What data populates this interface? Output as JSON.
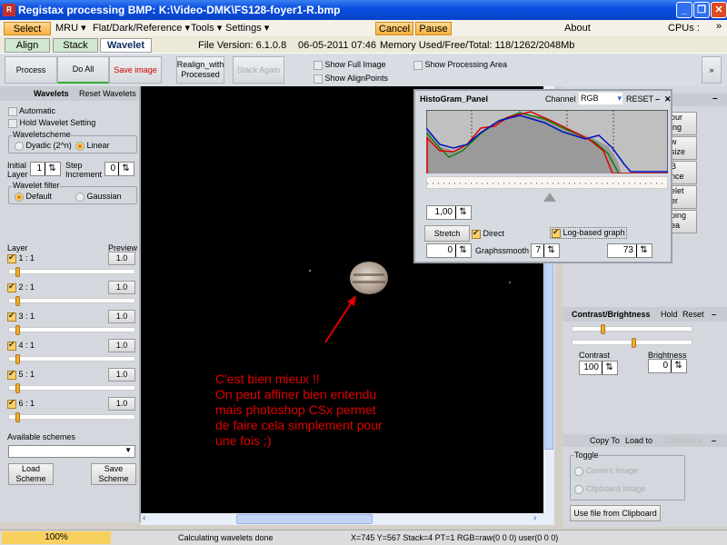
{
  "window": {
    "title": "Registax processing BMP: K:\\Video-DMK\\FS128-foyer1-R.bmp",
    "minimize": "_",
    "maximize": "❐",
    "close": "✕"
  },
  "menu": {
    "select": "Select",
    "mru": "MRU ▾",
    "flat": "Flat/Dark/Reference ▾",
    "tools": "Tools ▾",
    "settings": "Settings ▾",
    "cancel": "Cancel",
    "pause": "Pause",
    "about": "About",
    "cpus": "CPUs :",
    "more": "»"
  },
  "tabs": [
    {
      "label": "Align"
    },
    {
      "label": "Stack"
    },
    {
      "label": "Wavelet"
    }
  ],
  "info": {
    "version": "File Version: 6.1.0.8",
    "date": "06-05-2011 07:46",
    "memory": "Memory Used/Free/Total: 118/1262/2048Mb"
  },
  "toolbar": {
    "process": "Process",
    "do_all": "Do All",
    "save_image": "Save image",
    "realign1": "Realign_with",
    "realign2": "Processed",
    "stack_again": "Stack Again",
    "show_full": "Show Full Image",
    "show_align": "Show AlignPoints",
    "show_area": "Show Processing Area",
    "expand": "»"
  },
  "wavelets": {
    "title": "Wavelets",
    "reset": "Reset Wavelets",
    "automatic": "Automatic",
    "hold": "Hold Wavelet Setting",
    "scheme": "Waveletscheme",
    "dyadic": "Dyadic (2^n)",
    "linear": "Linear",
    "initial1": "Initial",
    "initial2": "Layer",
    "initial_val": "1",
    "step1": "Step",
    "step2": "Increment",
    "step_val": "0",
    "filter": "Wavelet filter",
    "default": "Default",
    "gaussian": "Gaussian",
    "layer": "Layer",
    "preview": "Preview",
    "layers": [
      {
        "label": "1 : 1",
        "value": "1.0",
        "checked": true
      },
      {
        "label": "2 : 1",
        "value": "1.0",
        "checked": true
      },
      {
        "label": "3 : 1",
        "value": "1.0",
        "checked": true
      },
      {
        "label": "4 : 1",
        "value": "1.0",
        "checked": true
      },
      {
        "label": "5 : 1",
        "value": "1.0",
        "checked": true
      },
      {
        "label": "6 : 1",
        "value": "1.0",
        "checked": true
      }
    ],
    "available": "Available schemes",
    "load": "Load Scheme",
    "save": "Save Scheme"
  },
  "histogram": {
    "title": "HistoGram_Panel",
    "channel": "Channel",
    "channel_value": "RGB",
    "reset": "RESET",
    "minimize": "–",
    "close": "✕",
    "gamma": "1,00",
    "stretch": "Stretch",
    "direct": "Direct",
    "log": "Log-based graph",
    "low": "0",
    "graphsmooth": "Graphssmooth",
    "smooth_val": "7",
    "high": "73",
    "colors": {
      "red": "#e00000",
      "green": "#108010",
      "blue": "#0010c0"
    }
  },
  "right": {
    "minimize": "–",
    "buttons": [
      "our\ning",
      "w\nsize",
      "B\nnce",
      "elet\ner",
      "ping\nea"
    ],
    "contrast_title": "Contrast/Brightness",
    "hold": "Hold",
    "reset": "Reset",
    "contrast": "Contrast",
    "contrast_val": "100",
    "brightness": "Brightness",
    "brightness_val": "0",
    "copy_to": "Copy To",
    "load_to": "Load to",
    "difference": "Difference",
    "toggle": "Toggle",
    "current": "Current Image",
    "clipboard": "Clipboard Image",
    "use_clipboard": "Use file from Clipboard"
  },
  "annotation": [
    "C'est bien mieux !!",
    "On peut affiner bien entendu",
    "mais photoshop CSx permet",
    "de faire cela simplement pour",
    "une fois ;)"
  ],
  "status": {
    "progress": "100%",
    "progress_value": 100,
    "message": "Calculating wavelets done",
    "coords": "X=745 Y=567 Stack=4 PT=1 RGB=raw(0 0 0) user(0 0 0)"
  }
}
